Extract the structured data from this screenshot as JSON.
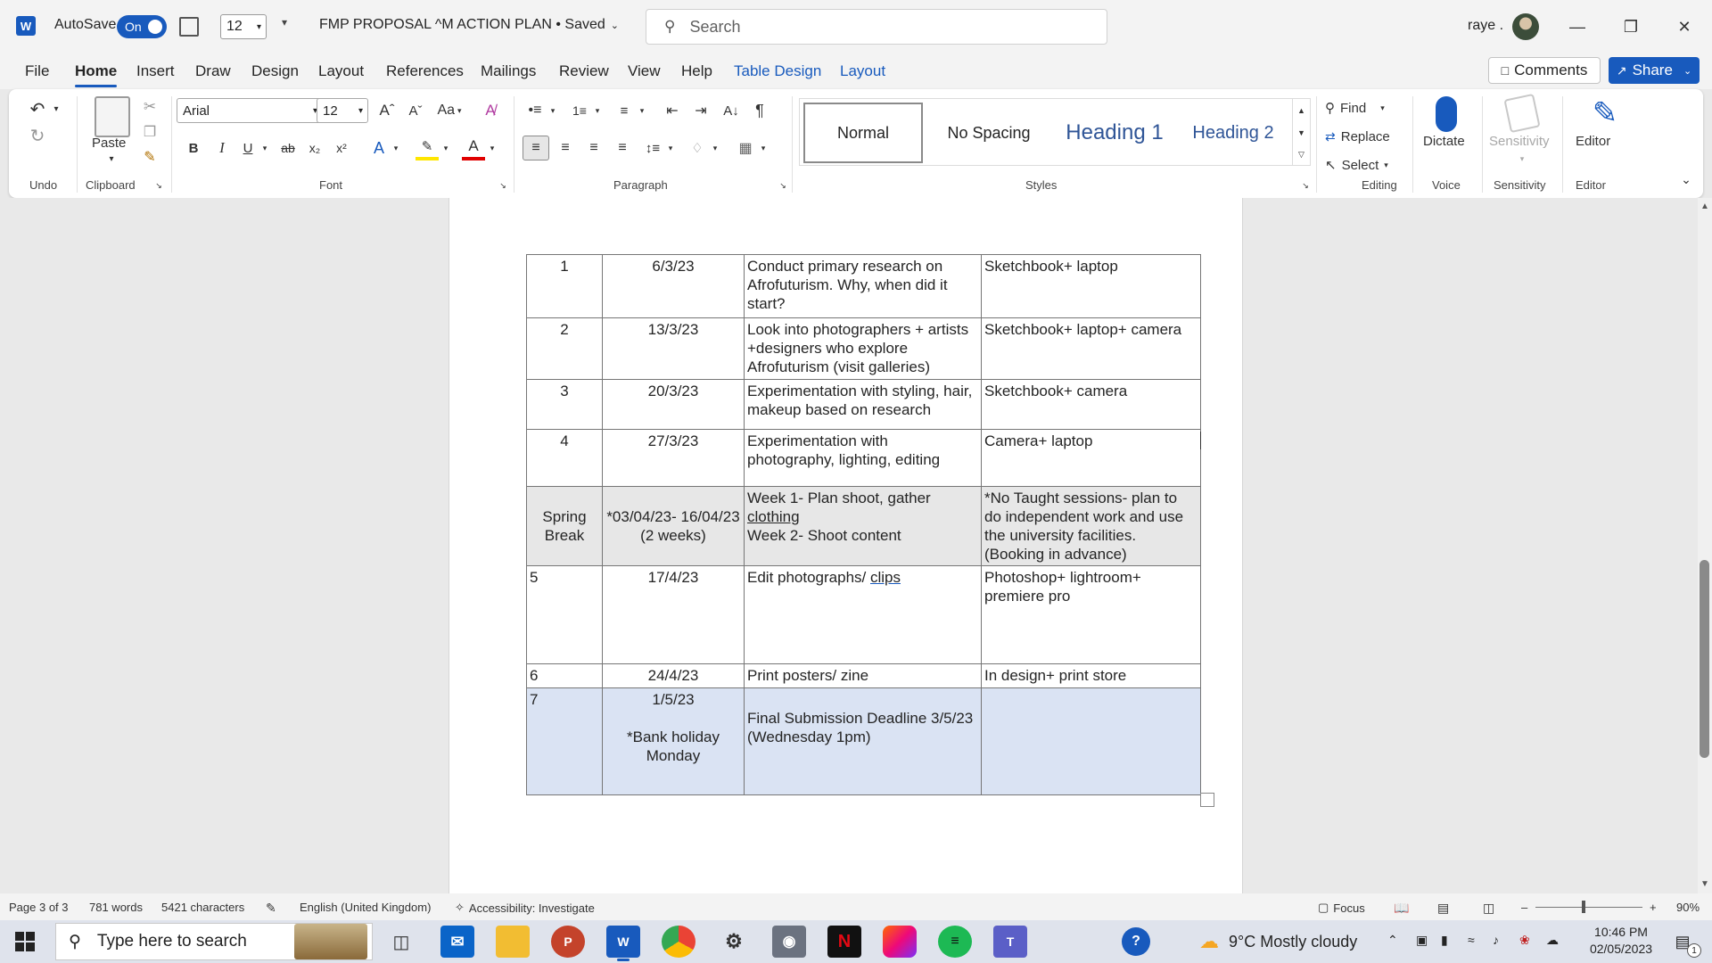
{
  "titlebar": {
    "autosave_label": "AutoSave",
    "autosave_state": "On",
    "font_size": "12",
    "doc_title": "FMP PROPOSAL ^M ACTION PLAN • Saved",
    "search_placeholder": "Search",
    "user_name": "raye ."
  },
  "menu": {
    "items": [
      "File",
      "Home",
      "Insert",
      "Draw",
      "Design",
      "Layout",
      "References",
      "Mailings",
      "Review",
      "View",
      "Help",
      "Table Design",
      "Layout"
    ],
    "active": "Home",
    "comments": "Comments",
    "share": "Share"
  },
  "ribbon": {
    "groups": {
      "undo": "Undo",
      "clipboard": "Clipboard",
      "font": "Font",
      "paragraph": "Paragraph",
      "styles": "Styles",
      "editing": "Editing",
      "voice": "Voice",
      "sensitivity": "Sensitivity",
      "editor": "Editor"
    },
    "paste": "Paste",
    "font_name": "Arial",
    "font_size": "12",
    "change_case": "Aa",
    "styles": [
      "Normal",
      "No Spacing",
      "Heading 1",
      "Heading 2"
    ],
    "find": "Find",
    "replace": "Replace",
    "select": "Select",
    "dictate": "Dictate",
    "sensitivity": "Sensitivity",
    "editor": "Editor"
  },
  "table": {
    "rows": [
      [
        "1",
        "6/3/23",
        "Conduct primary research on Afrofuturism. Why, when did it start?",
        "Sketchbook+ laptop"
      ],
      [
        "2",
        "13/3/23",
        "Look into photographers + artists +designers who explore Afrofuturism (visit galleries)",
        "Sketchbook+ laptop+ camera"
      ],
      [
        "3",
        "20/3/23",
        "Experimentation with styling, hair, makeup based on research",
        "Sketchbook+ camera"
      ],
      [
        "4",
        "27/3/23",
        "Experimentation with photography, lighting, editing",
        "Camera+ laptop"
      ]
    ],
    "spring": {
      "week_label": "Spring Break",
      "dates": "*03/04/23- 16/04/23 (2 weeks)",
      "task_line1_pre": "Week 1- Plan shoot, gather",
      "task_line1_link": "clothing",
      "task_line2": "Week 2- Shoot content",
      "resources": "*No Taught sessions- plan to do independent work and use the university facilities. (Booking in advance)"
    },
    "row5": {
      "week": "5",
      "date": "17/4/23",
      "task_pre": "Edit photographs/",
      "task_link": "clips",
      "resources": "Photoshop+ lightroom+ premiere pro"
    },
    "row6": {
      "week": "6",
      "date": "24/4/23",
      "task": "Print posters/ zine",
      "resources": "In design+ print store"
    },
    "row7": {
      "week": "7",
      "date": "1/5/23",
      "date_note": "*Bank holiday Monday",
      "task": "Final Submission Deadline 3/5/23 (Wednesday 1pm)",
      "resources": ""
    }
  },
  "status": {
    "page": "Page 3 of 3",
    "words": "781 words",
    "chars": "5421 characters",
    "language": "English (United Kingdom)",
    "accessibility": "Accessibility: Investigate",
    "focus": "Focus",
    "zoom": "90%"
  },
  "taskbar": {
    "search": "Type here to search",
    "weather": "9°C  Mostly cloudy",
    "time": "10:46 PM",
    "date": "02/05/2023",
    "notif_count": "1"
  },
  "colors": {
    "accent": "#185abd",
    "grey_row": "#e7e7e7",
    "blue_row": "#dae3f3"
  }
}
